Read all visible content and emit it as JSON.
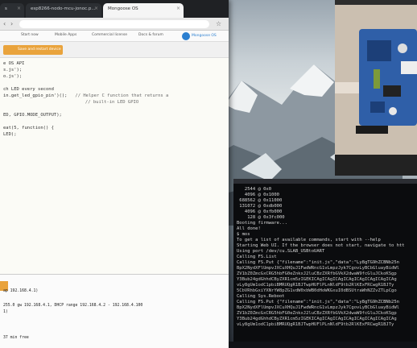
{
  "browser": {
    "tabs": [
      {
        "label": "s",
        "close": "×"
      },
      {
        "label": "esp8266-nodo-mcu-jonoc.p...",
        "close": "×"
      },
      {
        "label": "Mongoose OS",
        "close": "×"
      }
    ],
    "bookmarks": [
      "Start now",
      "Mobile Apps",
      "Commercial license",
      "Docs & forum"
    ],
    "brand": "Mongoose OS"
  },
  "toolbar": {
    "run_label": "Save and restart device"
  },
  "editor": {
    "lines": [
      {
        "text": "e OS API",
        "comment": ""
      },
      {
        "text": "s.js');",
        "comment": ""
      },
      {
        "text": "o.js');",
        "comment": ""
      },
      {
        "text": "",
        "comment": ""
      },
      {
        "text": "ch LED every second",
        "comment": ""
      },
      {
        "text": "in.get_led_gpio_pin')();",
        "comment": "   // Helper C function that returns a"
      },
      {
        "text": "",
        "comment": "   // built-in LED GPIO"
      },
      {
        "text": "",
        "comment": ""
      },
      {
        "text": "ED, GPIO.MODE_OUTPUT);",
        "comment": ""
      },
      {
        "text": "",
        "comment": ""
      },
      {
        "text": "eat(5, function() {",
        "comment": ""
      },
      {
        "text": "LED);",
        "comment": ""
      }
    ]
  },
  "console": {
    "lines": [
      "ap 192.168.4.1)",
      "",
      "255.0 gw 192.168.4.1, DHCP range 192.168.4.2 - 192.168.4.100",
      "1)",
      "",
      "",
      "",
      "",
      "37 min free"
    ]
  },
  "terminal": {
    "lines": [
      "   2544 @ 0x0",
      "   4096 @ 0x1000",
      " 688562 @ 0x11000",
      " 131072 @ 0xdb000",
      "   4096 @ 0xfb000",
      "    128 @ 0x3fc000",
      "Booting firmware...",
      "All done!",
      "$ mos",
      "To get a list of available commands, start with --help",
      "Starting Web UI. If the browser does not start, navigate to htt",
      "Using port /dev/cu.SLAB_USBtoUART",
      "Calling FS.List",
      "Calling FS.Put {\"filename\":\"init.js\",\"data\":\"Ly8gTG9hZCBNb25n",
      "BpX2NydXFlUmpvJXCuXHQuJ1FwdWRncG1vLmpzJyk7CgovLyBCbGluayBidWl",
      "ZV1bZ0ZmcGxCRG5hbFG0eZnkxJ2luCBzZXRfbGVkX2dwaW9fcGluJCkoKSgp",
      "Y3Bub24gdGhhdCByZXR1cm5zIGEKICAgICAgICAgICAgICAgICAgICAgICAg",
      "vLy8gUm1odC1pbiBMRUQgR1BJTwpHUFlPLnNldF9tb2RlKExFRCwgR1BJTy",
      "5CbVRhbGxiYXNrYW8pZG1vdW0xbWB0dHoWKGxuI0dBSUtraWhNZZvZTLpCgo",
      "Calling Sys.Reboot",
      "Calling FS.Put {\"filename\":\"init.js\",\"data\":\"Ly8gTG9hZCBNb25n",
      "BpX2NydXFlUmpvJXCuXHQuJ1FwdWRncG1vLmpzJyk7CgovLyBCbGluayBidWl",
      "ZV1bZ0ZmcGxCRG5hbFG0eZnkxJ2luCBzZXRfbGVkX2dwaW9fcGluJCkoKSgp",
      "Y3Bub24gdGhhdCByZXR1cm5zIGEKICAgICAgICAgICAgICAgICAgICAgICAg",
      "vLy8gUm1odC1pbiBMRUQgR1BJTwpHUFlPLnNldF9tb2RlKExFRCwgR1BJTy"
    ]
  }
}
